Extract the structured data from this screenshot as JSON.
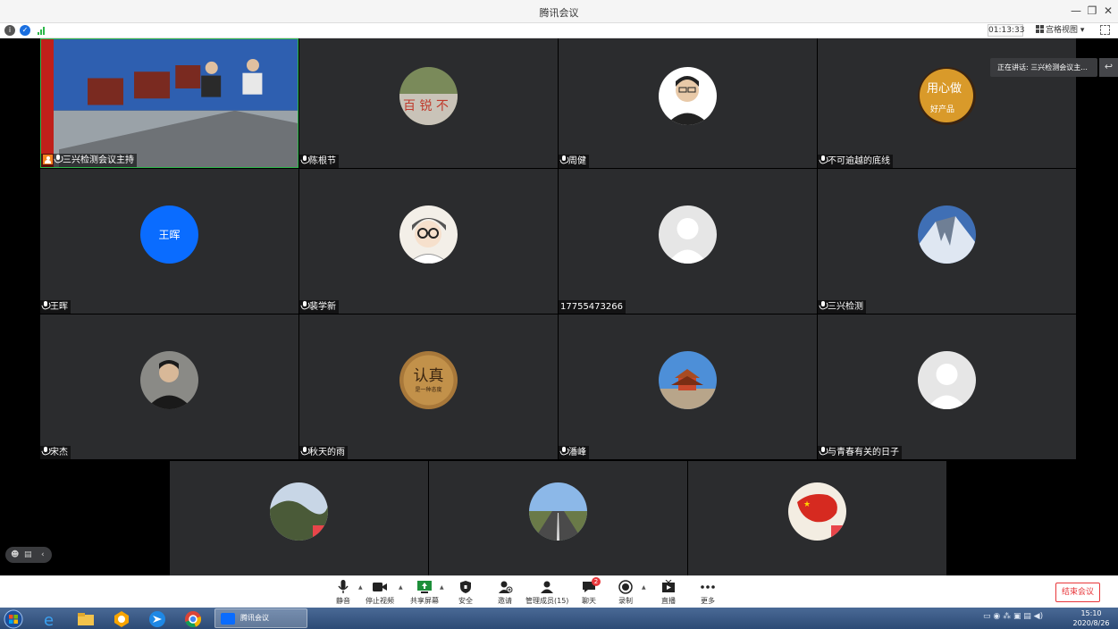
{
  "window": {
    "title": "腾讯会议"
  },
  "toolbar": {
    "timer": "01:13:33",
    "view_label": "宫格视图"
  },
  "speaking": {
    "text": "正在讲话: 三兴检测会议主..."
  },
  "tiles": [
    {
      "name": "三兴检测会议主持",
      "avatar": "meeting-room-photo",
      "host": true
    },
    {
      "name": "陈根节",
      "avatar": "rock-photo"
    },
    {
      "name": "周健",
      "avatar": "man-portrait"
    },
    {
      "name": "不可逾越的底线",
      "avatar": "calligraphy-sign"
    },
    {
      "name": "王晖",
      "avatar": "blue-circle",
      "avatar_text": "王晖"
    },
    {
      "name": "裴学新",
      "avatar": "cartoon-glasses"
    },
    {
      "name": "17755473266",
      "avatar": "default-silhouette",
      "no_mic": true
    },
    {
      "name": "三兴检测",
      "avatar": "snow-mountain"
    },
    {
      "name": "宋杰",
      "avatar": "man-photo-dark"
    },
    {
      "name": "秋天的雨",
      "avatar": "renzhen-badge",
      "avatar_text": "认真",
      "avatar_subtext": "是一种态度"
    },
    {
      "name": "潘峰",
      "avatar": "temple-photo"
    },
    {
      "name": "与青春有关的日子",
      "avatar": "default-silhouette"
    },
    {
      "name": "",
      "avatar": "hill-photo"
    },
    {
      "name": "",
      "avatar": "road-photo"
    },
    {
      "name": "",
      "avatar": "china-map"
    }
  ],
  "controls": [
    {
      "id": "mute",
      "label": "静音",
      "icon": "microphone-icon"
    },
    {
      "id": "video",
      "label": "停止视频",
      "icon": "camera-icon"
    },
    {
      "id": "share",
      "label": "共享屏幕",
      "icon": "share-screen-icon"
    },
    {
      "id": "security",
      "label": "安全",
      "icon": "shield-icon"
    },
    {
      "id": "invite",
      "label": "邀请",
      "icon": "add-user-icon"
    },
    {
      "id": "members",
      "label": "管理成员(15)",
      "icon": "members-icon"
    },
    {
      "id": "chat",
      "label": "聊天",
      "icon": "chat-icon",
      "badge": "2"
    },
    {
      "id": "record",
      "label": "录制",
      "icon": "record-icon"
    },
    {
      "id": "live",
      "label": "直播",
      "icon": "live-icon"
    },
    {
      "id": "more",
      "label": "更多",
      "icon": "more-icon"
    }
  ],
  "end_button": "结束会议",
  "taskbar": {
    "active_app": "腾讯会议",
    "time": "15:10",
    "date": "2020/8/26"
  },
  "colors": {
    "accent": "#0a6cff",
    "active_border": "#2db84a",
    "end": "#e8363a",
    "tile_bg": "#2b2c2e"
  }
}
